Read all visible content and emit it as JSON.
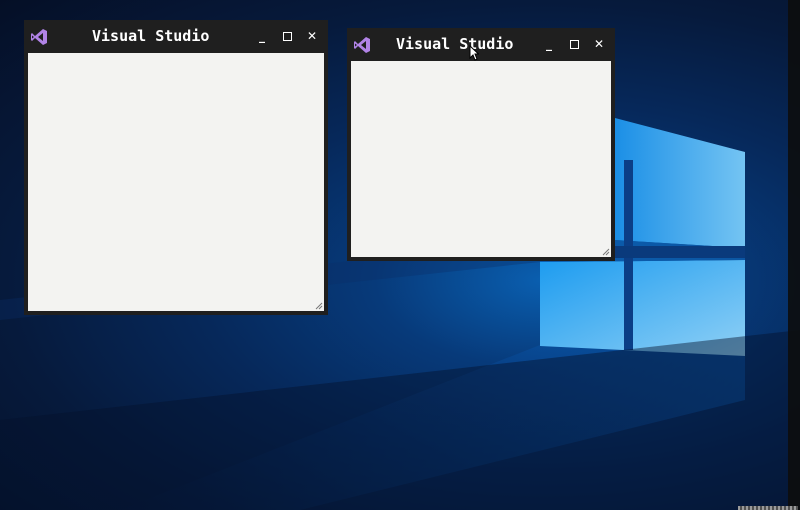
{
  "desktop": {
    "wallpaper": "windows-10-hero",
    "accent_color": "#0a78d7"
  },
  "windows": [
    {
      "title": "Visual Studio",
      "icon": "visual-studio-logo-icon",
      "controls": {
        "minimize": "_",
        "maximize": "□",
        "close": "✕"
      },
      "client_color": "#f3f3f1"
    },
    {
      "title": "Visual Studio",
      "icon": "visual-studio-logo-icon",
      "controls": {
        "minimize": "_",
        "maximize": "□",
        "close": "✕"
      },
      "client_color": "#f3f3f1"
    }
  ]
}
